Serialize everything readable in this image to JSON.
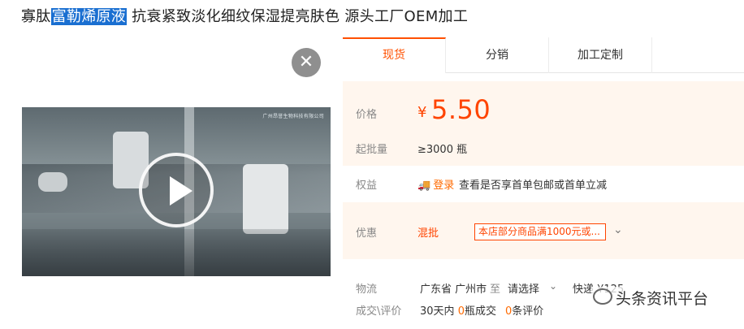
{
  "title": {
    "prefix": "寡肽",
    "highlight": "富勒烯原液",
    "suffix": "抗衰紧致淡化细纹保湿提亮肤色 源头工厂OEM加工"
  },
  "video": {
    "watermark": "广州昂誉生物科技有限公司",
    "close_icon": "✕"
  },
  "tabs": [
    {
      "label": "现货"
    },
    {
      "label": "分销"
    },
    {
      "label": "加工定制"
    }
  ],
  "price": {
    "label": "价格",
    "currency": "¥",
    "value": "5.50"
  },
  "moq": {
    "label": "起批量",
    "value": "≥3000 瓶"
  },
  "rights": {
    "label": "权益",
    "login": "登录",
    "text": "查看是否享首单包邮或首单立减"
  },
  "promo": {
    "label": "优惠",
    "tag": "混批",
    "box_text": "本店部分商品满1000元或..."
  },
  "logistics": {
    "label": "物流",
    "from": "广东省 广州市",
    "to": "至",
    "select": "请选择",
    "express": "快递 ¥125"
  },
  "trade": {
    "label": "成交\\评价",
    "days": "30天内",
    "deal_count": "0",
    "deal_suffix": "瓶成交",
    "review_count": "0",
    "review_suffix": "条评价"
  },
  "source_watermark": "头条资讯平台",
  "colors": {
    "accent": "#ff5000",
    "price": "#ff4400",
    "highlight": "#1a6fd1"
  }
}
